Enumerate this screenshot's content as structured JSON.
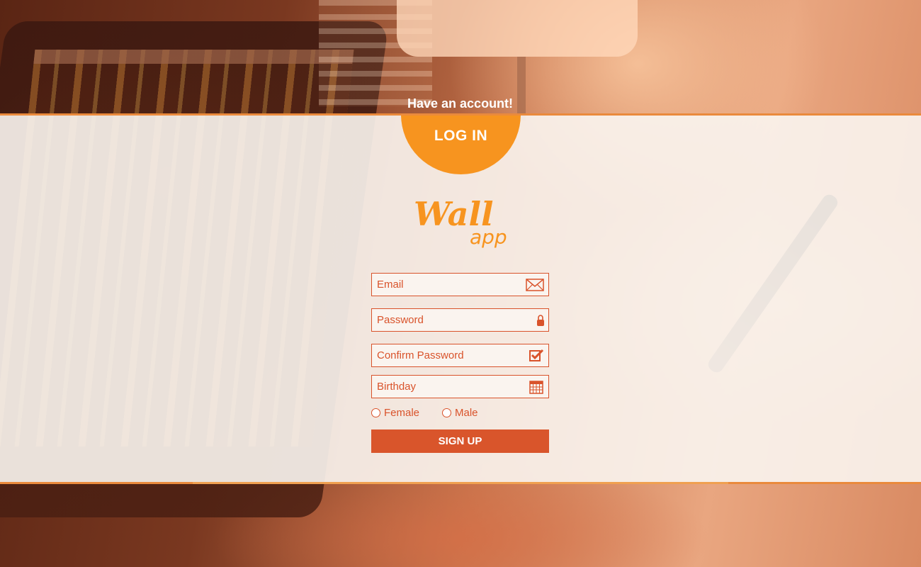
{
  "header": {
    "have_account": "Have an account!",
    "login_label": "LOG IN"
  },
  "logo": {
    "title": "Wall",
    "subtitle": "app"
  },
  "form": {
    "email_placeholder": "Email",
    "password_placeholder": "Password",
    "confirm_placeholder": "Confirm Password",
    "birthday_placeholder": "Birthday",
    "gender_female": "Female",
    "gender_male": "Male",
    "signup_label": "SIGN UP"
  },
  "icons": {
    "email": "envelope-icon",
    "password": "lock-icon",
    "confirm": "checkbox-icon",
    "birthday": "calendar-icon"
  },
  "colors": {
    "accent_orange": "#f7941f",
    "accent_red": "#d9552b",
    "band_bg": "#faf4ef"
  }
}
